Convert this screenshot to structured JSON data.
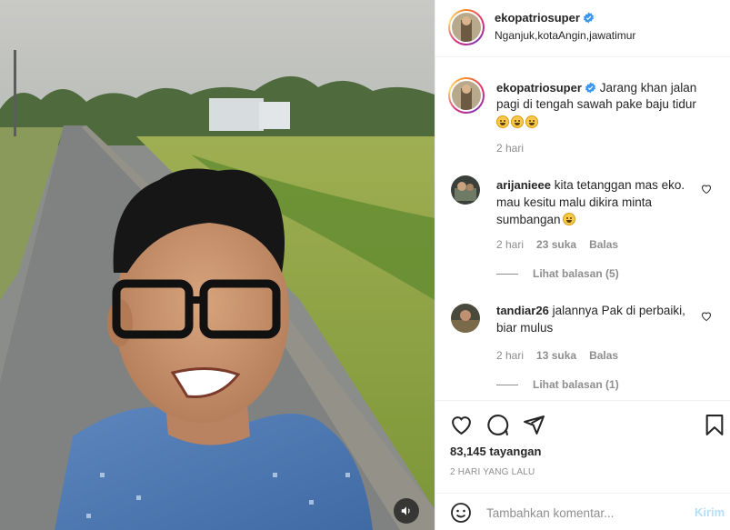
{
  "post": {
    "username": "ekopatriosuper",
    "location": "Nganjuk,kotaAngin,jawatimur",
    "caption": "Jarang khan jalan pagi di tengah sawah pake baju tidur",
    "caption_time": "2 hari"
  },
  "comments": [
    {
      "username": "arijanieee",
      "text": "kita tetanggan mas eko. mau kesitu malu dikira minta sumbangan",
      "time": "2 hari",
      "likes": "23 suka",
      "reply_label": "Balas",
      "view_replies": "Lihat balasan (5)"
    },
    {
      "username": "tandiar26",
      "text": "jalannya Pak di perbaiki, biar mulus",
      "time": "2 hari",
      "likes": "13 suka",
      "reply_label": "Balas",
      "view_replies": "Lihat balasan (1)"
    }
  ],
  "stats": {
    "views": "83,145 tayangan",
    "date": "2 HARI YANG LALU"
  },
  "composer": {
    "placeholder": "Tambahkan komentar...",
    "post_label": "Kirim"
  },
  "icons": {
    "like": "heart-icon",
    "comment": "comment-icon",
    "share": "send-icon",
    "save": "bookmark-icon",
    "emoji": "emoji-icon",
    "sound": "speaker-icon",
    "verified": "verified-badge-icon"
  },
  "colors": {
    "verified": "#3897f0",
    "secondary_text": "#8e8e8e",
    "post_button_disabled": "#b2dffc"
  }
}
